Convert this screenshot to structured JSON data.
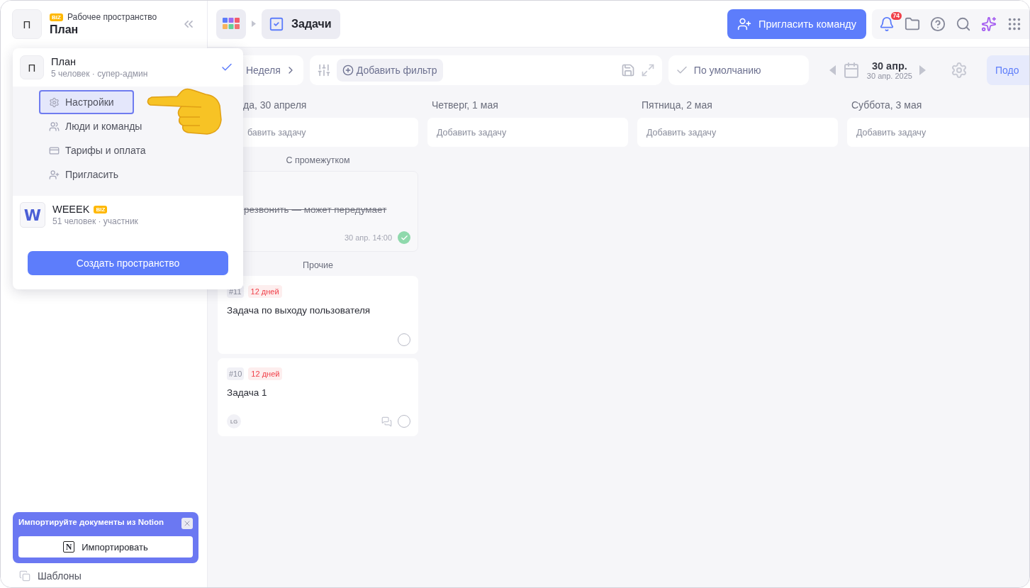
{
  "sidebar": {
    "workspace": {
      "avatar": "П",
      "badge": "BIZ",
      "label": "Рабочее пространство",
      "name": "План"
    },
    "import_banner": {
      "title": "Импортируйте документы из Notion",
      "logo_letter": "N",
      "button": "Импортировать"
    },
    "footer_item": "Шаблоны"
  },
  "workspace_menu": {
    "workspaces": [
      {
        "avatar": "П",
        "kind": "letter",
        "name": "План",
        "meta": "5 человек · супер-админ",
        "selected": true,
        "items": [
          {
            "label": "Настройки",
            "kind": "gear",
            "selected": true
          },
          {
            "label": "Люди и команды",
            "kind": "people",
            "selected": false
          },
          {
            "label": "Тарифы и оплата",
            "kind": "card",
            "selected": false
          },
          {
            "label": "Пригласить",
            "kind": "invite",
            "selected": false
          }
        ]
      },
      {
        "avatar": "W",
        "kind": "logo",
        "name": "WEEEK",
        "badge": "BIZ",
        "meta": "51 человек · участник",
        "selected": false
      }
    ],
    "create_button": "Создать пространство"
  },
  "topbar": {
    "breadcrumb": "Задачи",
    "invite_button": "Пригласить команду",
    "notification_count": "74"
  },
  "toolbar": {
    "period": "Неделя",
    "add_filter": "Добавить фильтр",
    "sort": "По умолчанию",
    "date": "30 апр.",
    "date_sub": "30 апр. 2025",
    "cut_button": "Подо"
  },
  "columns": [
    {
      "title": "да, 30 апреля",
      "add_placeholder": "бавить задачу",
      "groups": [
        {
          "title": "С промежутком",
          "cards": [
            {
              "title": "резвонить — может передумает",
              "time": "30 апр. 14:00",
              "done": true
            }
          ]
        },
        {
          "title": "Прочие",
          "cards": [
            {
              "id": "#11",
              "due": "12 дней",
              "title": "Задача по выходу пользователя",
              "done": false
            },
            {
              "id": "#10",
              "due": "12 дней",
              "title": "Задача 1",
              "assignee": "LG",
              "comments": true,
              "done": false
            }
          ]
        }
      ]
    },
    {
      "title": "Четверг, 1 мая",
      "add_placeholder": "Добавить задачу"
    },
    {
      "title": "Пятница, 2 мая",
      "add_placeholder": "Добавить задачу"
    },
    {
      "title": "Суббота, 3 мая",
      "add_placeholder": "Добавить задачу"
    }
  ]
}
